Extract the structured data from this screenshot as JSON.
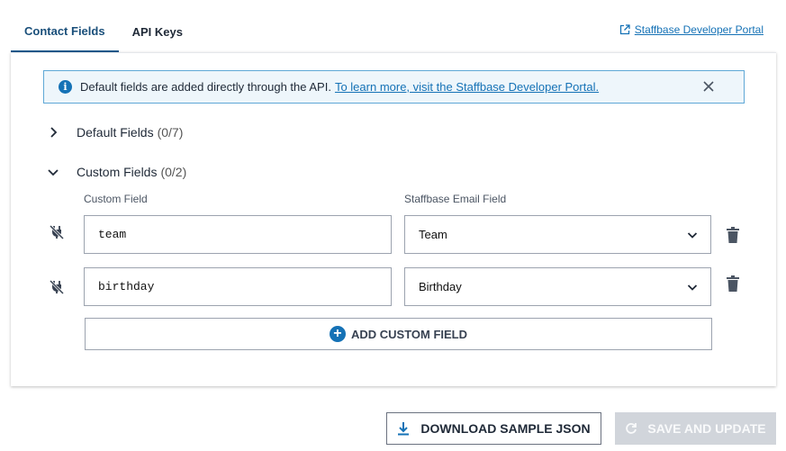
{
  "tabs": [
    {
      "label": "Contact Fields",
      "active": true
    },
    {
      "label": "API Keys",
      "active": false
    }
  ],
  "portal_link": {
    "label": "Staffbase Developer Portal",
    "icon": "external-link-icon"
  },
  "banner": {
    "icon": "info-icon",
    "text": "Default fields are added directly through the API.",
    "link": "To learn more, visit the Staffbase Developer Portal.",
    "close_icon": "close-icon"
  },
  "sections": {
    "default": {
      "label": "Default Fields",
      "count": "(0/7)",
      "expanded": false
    },
    "custom": {
      "label": "Custom Fields",
      "count": "(0/2)",
      "expanded": true
    }
  },
  "columns": {
    "custom_field": "Custom Field",
    "email_field": "Staffbase Email Field"
  },
  "rows": [
    {
      "field": "team",
      "email_field": "Team"
    },
    {
      "field": "birthday",
      "email_field": "Birthday"
    }
  ],
  "add_button": {
    "label": "ADD CUSTOM FIELD"
  },
  "download_button": {
    "label": "DOWNLOAD SAMPLE JSON"
  },
  "save_button": {
    "label": "SAVE AND UPDATE",
    "disabled": true
  },
  "colors": {
    "accent": "#1572b6",
    "active_tab": "#1a5a8c",
    "banner_bg": "#eef6fb",
    "disabled_bg": "#d1d5db"
  }
}
